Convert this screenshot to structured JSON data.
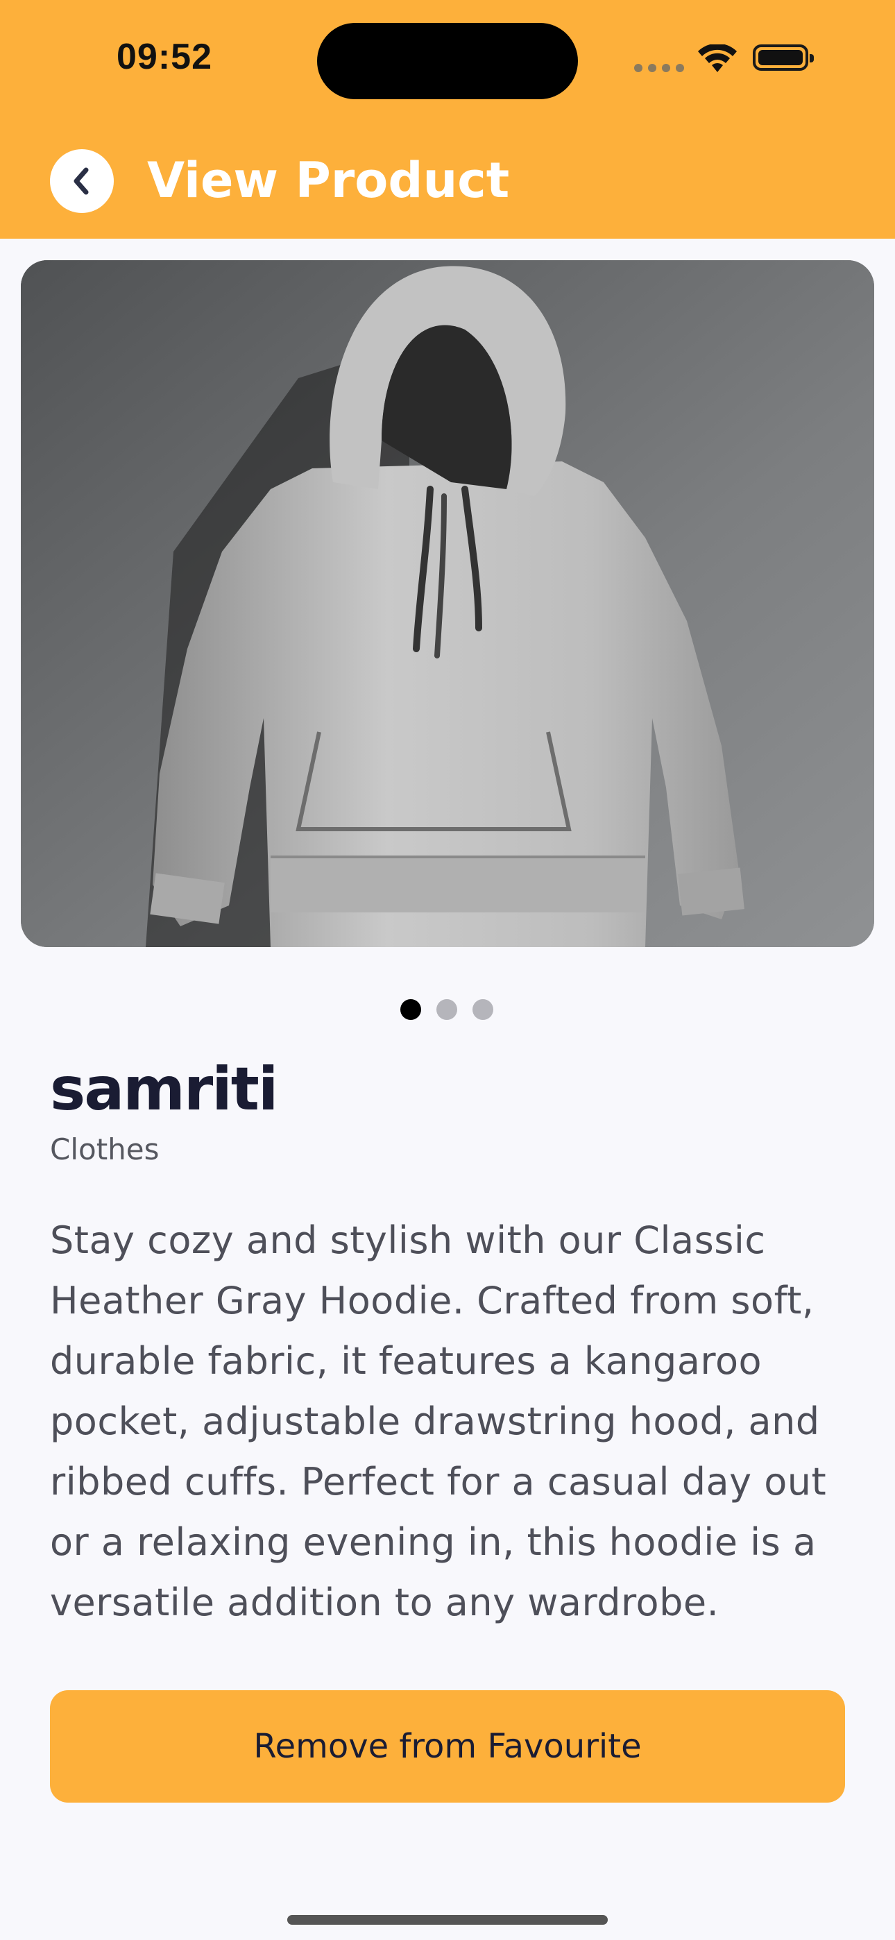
{
  "status_bar": {
    "time": "09:52"
  },
  "header": {
    "title": "View Product"
  },
  "carousel": {
    "image_alt": "Heather gray hoodie",
    "pages": 3,
    "active_index": 0
  },
  "product": {
    "name": "samriti",
    "category": "Clothes",
    "description": "Stay cozy and stylish with our Classic Heather Gray Hoodie. Crafted from soft, durable fabric, it features a kangaroo pocket, adjustable drawstring hood, and ribbed cuffs. Perfect for a casual day out or a relaxing evening in, this hoodie is a versatile addition to any wardrobe."
  },
  "actions": {
    "remove_favourite_label": "Remove from Favourite"
  },
  "colors": {
    "accent": "#FDB03B",
    "background": "#F8F8FC",
    "text": "#1A1C33"
  }
}
